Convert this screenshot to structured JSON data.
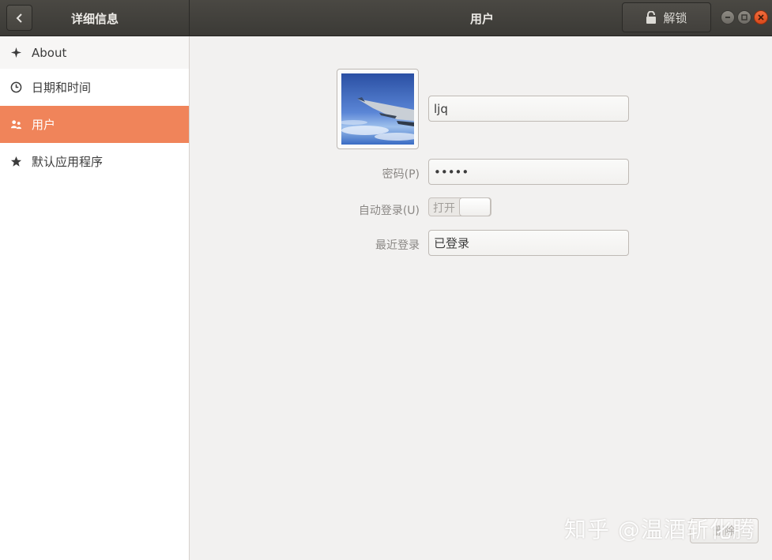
{
  "header": {
    "sidebar_title": "详细信息",
    "main_title": "用户",
    "unlock_label": "解锁"
  },
  "sidebar": {
    "items": [
      {
        "label": "About",
        "icon": "sparkle-icon"
      },
      {
        "label": "日期和时间",
        "icon": "clock-icon"
      },
      {
        "label": "用户",
        "icon": "users-icon",
        "selected": true
      },
      {
        "label": "默认应用程序",
        "icon": "star-icon"
      }
    ]
  },
  "user": {
    "username": "ljq",
    "password_label": "密码(P)",
    "password_value": "•••••",
    "autologin_label": "自动登录(U)",
    "autologin_state": "打开",
    "last_login_label": "最近登录",
    "last_login_value": "已登录",
    "remove_label": "删除"
  },
  "watermark": "知乎 @温酒斩化腾",
  "colors": {
    "accent": "#f0845a",
    "headerbar": "#3f3e3a",
    "close_button": "#e45a27"
  }
}
